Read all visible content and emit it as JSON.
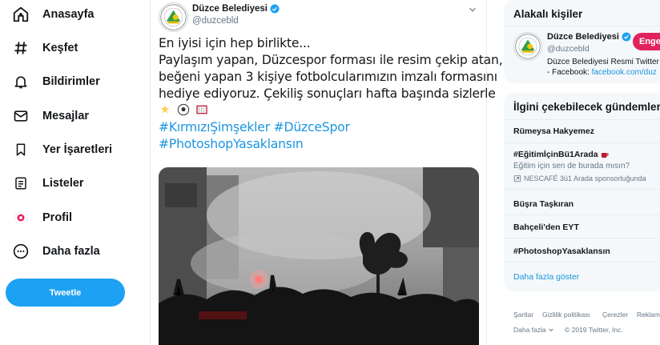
{
  "nav": {
    "items": [
      {
        "label": "Anasayfa",
        "icon": "home-icon"
      },
      {
        "label": "Keşfet",
        "icon": "hashtag-icon"
      },
      {
        "label": "Bildirimler",
        "icon": "bell-icon"
      },
      {
        "label": "Mesajlar",
        "icon": "envelope-icon"
      },
      {
        "label": "Yer İşaretleri",
        "icon": "bookmark-icon"
      },
      {
        "label": "Listeler",
        "icon": "list-icon"
      },
      {
        "label": "Profil",
        "icon": "profile-avatar-icon"
      },
      {
        "label": "Daha fazla",
        "icon": "more-icon"
      }
    ],
    "tweet_button": "Tweetle"
  },
  "tweet": {
    "author_name": "Düzce Belediyesi",
    "author_handle": "@duzcebld",
    "lines": [
      "En iyisi için hep birlikte...",
      "Paylaşım yapan, Düzcespor forması ile resim çekip atan,",
      "beğeni yapan 3 kişiye fotbolcularımızın imzalı formasını",
      "hediye ediyoruz. Çekiliş sonuçları hafta başında sizlerle"
    ],
    "hashtags_line1": "#KırmızıŞimşekler #DüzceSpor",
    "hashtags_line2": "#PhotoshopYasaklansın"
  },
  "related": {
    "title": "Alakalı kişiler",
    "person": {
      "name": "Düzce Belediyesi",
      "handle": "@duzcebld",
      "bio_line1": "Düzce Belediyesi Resmi Twitter",
      "bio_prefix": "- Facebook: ",
      "bio_link": "facebook.com/duz",
      "follow_label": "Engel"
    }
  },
  "trends": {
    "title": "İlgini çekebilecek gündemler",
    "items": [
      {
        "name": "Rümeysa Hakyemez"
      },
      {
        "name": "#EğitimİçinBü1Arada",
        "sub": "Eğitim için sen de burada mısın?",
        "promo": "NESCAFÉ 3ü1 Arada sponsorluğunda"
      },
      {
        "name": "Büşra Taşkıran"
      },
      {
        "name": "Bahçeli'den EYT"
      },
      {
        "name": "#PhotoshopYasaklansın"
      }
    ],
    "show_more": "Daha fazla göster"
  },
  "footer": {
    "links": [
      "Şartlar",
      "Gizlilik politikası",
      "Çerezler",
      "Reklam"
    ],
    "more": "Daha fazla",
    "copyright": "© 2019 Twitter, Inc."
  },
  "colors": {
    "accent": "#1da1f2",
    "link": "#1b95e0",
    "follow": "#e0245e",
    "muted": "#657786"
  }
}
